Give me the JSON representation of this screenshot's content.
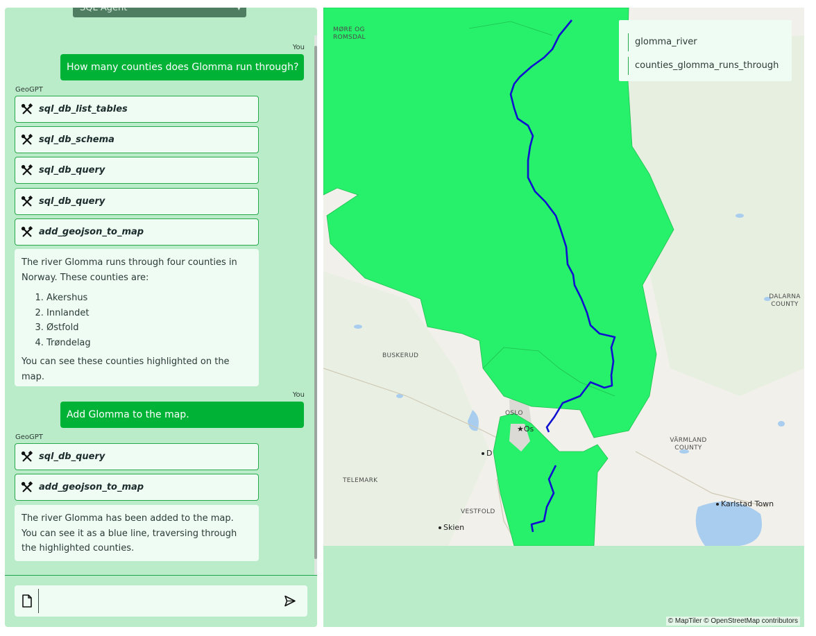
{
  "agent_select": {
    "value": "SQL Agent"
  },
  "colors": {
    "accent": "#00b336",
    "county_fill": "#27f06a",
    "river": "#1010d0",
    "panel_bg": "#bbecc9"
  },
  "chat": {
    "messages": [
      {
        "sender": "You",
        "text": "How many counties does Glomma run through?"
      },
      {
        "sender": "GeoGPT",
        "tools": [
          "sql_db_list_tables",
          "sql_db_schema",
          "sql_db_query",
          "sql_db_query",
          "add_geojson_to_map"
        ],
        "intro": "The river Glomma runs through four counties in Norway. These counties are:",
        "list": [
          "Akershus",
          "Innlandet",
          "Østfold",
          "Trøndelag"
        ],
        "outro": "You can see these counties highlighted on the map."
      },
      {
        "sender": "You",
        "text": "Add Glomma to the map."
      },
      {
        "sender": "GeoGPT",
        "tools": [
          "sql_db_query",
          "add_geojson_to_map"
        ],
        "text": "The river Glomma has been added to the map. You can see it as a blue line, traversing through the highlighted counties."
      }
    ],
    "input_value": "",
    "icons": {
      "tool": "wrench-screwdriver-icon",
      "attach": "file-icon",
      "send": "send-icon"
    }
  },
  "map": {
    "legend": [
      "glomma_river",
      "counties_glomma_runs_through"
    ],
    "labels": {
      "more_romsdal": "MØRE OG\nROMSDAL",
      "dalarna": "DALARNA\nCOUNTY",
      "buskerud": "BUSKERUD",
      "varmland": "VÄRMLAND\nCOUNTY",
      "telemark": "TELEMARK",
      "vestfold": "VESTFOLD",
      "oslo": "OSLO"
    },
    "cities": {
      "oslo": "Os",
      "drammen": "D",
      "skien": "Skien",
      "karlstad": "Karlstad Town"
    },
    "attribution": "© MapTiler © OpenStreetMap contributors"
  }
}
